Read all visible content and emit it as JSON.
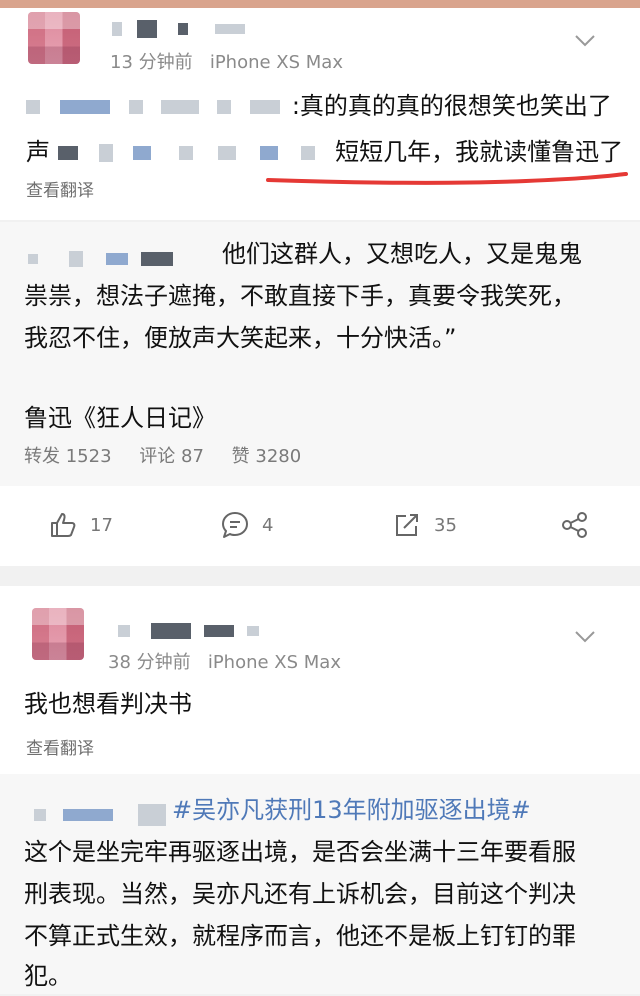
{
  "post1": {
    "meta": "13 分钟前",
    "device": "iPhone XS Max",
    "line1": ":真的真的真的很想笑也笑出了",
    "line2_prefix": "声",
    "line2_suffix": "短短几年，我就读懂鲁迅了",
    "translate": "查看翻译"
  },
  "quote1": {
    "lines": [
      "他们这群人，又想吃人，又是鬼鬼",
      "祟祟，想法子遮掩，不敢直接下手，真要令我笑死，",
      "我忍不住，便放声大笑起来，十分快活。”"
    ],
    "source": "鲁迅《狂人日记》",
    "stats": {
      "repost": "转发 1523",
      "comment": "评论 87",
      "like": "赞 3280"
    }
  },
  "actions": {
    "like_count": "17",
    "comment_count": "4",
    "share_count": "35"
  },
  "post2": {
    "meta": "38 分钟前",
    "device": "iPhone XS Max",
    "text": "我也想看判决书",
    "translate": "查看翻译"
  },
  "quote2": {
    "topic": "#吴亦凡获刑13年附加驱逐出境#",
    "lines": [
      "这个是坐完牢再驱逐出境，是否会坐满十三年要看服",
      "刑表现。当然，吴亦凡还有上诉机会，目前这个判决",
      "不算正式生效，就程序而言，他还不是板上钉钉的罪",
      "犯。"
    ]
  },
  "colors": {
    "underline": "#e53935",
    "topic": "#4f79b8"
  }
}
